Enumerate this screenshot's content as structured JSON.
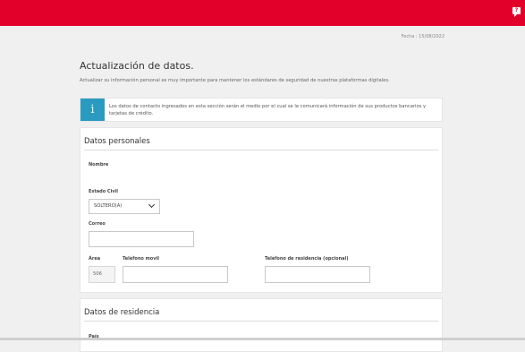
{
  "header": {
    "chat_icon_label": "?"
  },
  "date_text": "Fecha : 15/08/2022",
  "page": {
    "title": "Actualización de datos.",
    "subtitle": "Actualizar su información personal es muy importante para mantener los estándares de seguridad de nuestras plataformas digitales."
  },
  "info": {
    "icon": "i",
    "text": "Los datos de contacto ingresados en esta sección serán el medio por el cual se le comunicará información de sus productos bancarios y tarjetas de crédito."
  },
  "personal": {
    "title": "Datos personales",
    "name_label": "Nombre",
    "civil_label": "Estado Civil",
    "civil_value": "SOLTERO(A)",
    "email_label": "Correo",
    "email_value": "",
    "area_label": "Área",
    "area_value": "506",
    "mobile_label": "Teléfono movil",
    "mobile_value": "",
    "home_label": "Teléfono de residencia (opcional)",
    "home_value": ""
  },
  "residence": {
    "title": "Datos de residencia",
    "country_label": "País"
  },
  "colors": {
    "brand": "#e2002b",
    "info": "#2a9bc0"
  }
}
